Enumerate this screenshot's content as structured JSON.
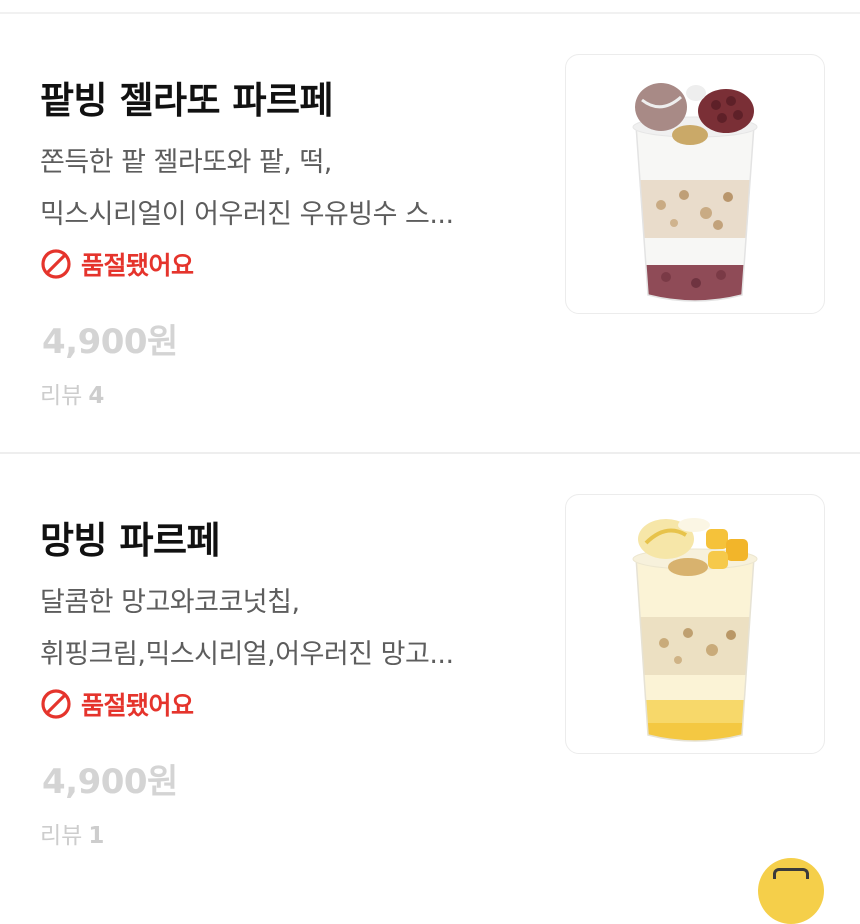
{
  "items": [
    {
      "name": "팥빙 젤라또 파르페",
      "desc_line1": "쫀득한 팥 젤라또와 팥, 떡,",
      "desc_line2": "믹스시리얼이 어우러진 우유빙수 스...",
      "status": "품절됐어요",
      "price": "4,900원",
      "review_label": "리뷰",
      "review_count": "4",
      "image_icon": "redbean-parfait-cup-image"
    },
    {
      "name": "망빙 파르페",
      "desc_line1": "달콤한 망고와코코넛칩,",
      "desc_line2": "휘핑크림,믹스시리얼,어우러진 망고...",
      "status": "품절됐어요",
      "price": "4,900원",
      "review_label": "리뷰",
      "review_count": "1",
      "image_icon": "mango-parfait-cup-image"
    }
  ],
  "colors": {
    "sold_out": "#e5342c",
    "price_disabled": "#d4d4d4",
    "fab": "#f5cf4a"
  }
}
